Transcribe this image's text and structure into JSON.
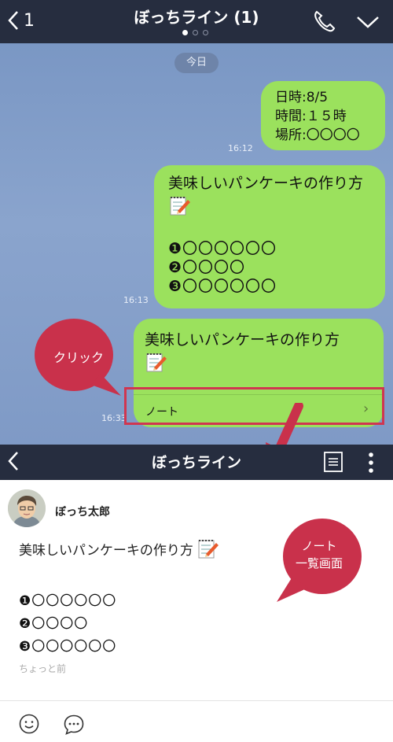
{
  "chat_header": {
    "back_count": "1",
    "title": "ぼっちライン (1)"
  },
  "chat": {
    "date_label": "今日",
    "messages": [
      {
        "lines": [
          "日時:8/5",
          "時間:１５時",
          "場所:〇〇〇〇"
        ],
        "time": "16:12"
      },
      {
        "title": "美味しいパンケーキの作り方",
        "lines": [
          "❶〇〇〇〇〇〇",
          "❷〇〇〇〇",
          "❸〇〇〇〇〇〇"
        ],
        "time": "16:13"
      },
      {
        "title": "美味しいパンケーキの作り方",
        "note_label": "ノート",
        "time": "16:33"
      }
    ]
  },
  "callouts": {
    "click": "クリック",
    "note_list_line1": "ノート",
    "note_list_line2": "一覧画面"
  },
  "note_header": {
    "title": "ぼっちライン"
  },
  "note": {
    "author": "ぼっち太郎",
    "title": "美味しいパンケーキの作り方",
    "lines": [
      "❶〇〇〇〇〇〇",
      "❷〇〇〇〇",
      "❸〇〇〇〇〇〇"
    ],
    "time": "ちょっと前"
  },
  "colors": {
    "header_bg": "#262d3f",
    "bubble_green": "#9be15d",
    "callout_red": "#c9314b"
  }
}
